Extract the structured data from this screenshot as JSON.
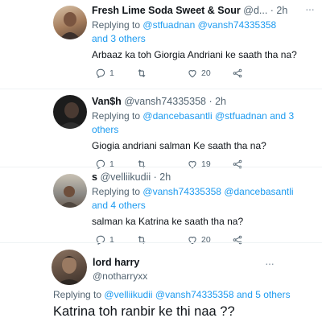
{
  "tweets": [
    {
      "name": "Fresh Lime Soda Sweet & Sour",
      "handle": "@d...",
      "time": "· 2h",
      "replying_prefix": "Replying to",
      "replying_mentions": "@stfuadnan @vansh74335358",
      "replying_suffix": "and 3 others",
      "text": "Arbaaz ka toh Giorgia Andriani ke saath tha na?",
      "replies": "1",
      "likes": "20"
    },
    {
      "name": "Van$h",
      "handle": "@vansh74335358 · 2h",
      "replying_prefix": "Replying to",
      "replying_mentions": "@dancebasantli @stfuadnan and 3 others",
      "text": "Giogia andriani salman Ke saath tha na?",
      "replies": "1",
      "likes": "19"
    },
    {
      "name": "s",
      "handle": "@velliikudii · 2h",
      "replying_prefix": "Replying to",
      "replying_mentions": "@vansh74335358 @dancebasantli and 4 others",
      "text": "salman ka Katrina ke saath tha na?",
      "replies": "1",
      "likes": "20"
    }
  ],
  "main_tweet": {
    "name": "lord harry",
    "handle": "@notharryxx",
    "replying_prefix": "Replying to",
    "replying_mentions": "@velliikudii @vansh74335358",
    "replying_suffix": "and 5 others",
    "text": "Katrina toh ranbir ke thi naa ??"
  },
  "icons": [
    "reply-icon",
    "retweet-icon",
    "like-icon",
    "share-icon",
    "more-icon"
  ],
  "colors": {
    "link": "#1d9bf0",
    "secondary": "#536471",
    "primary_text": "#0f1419"
  }
}
